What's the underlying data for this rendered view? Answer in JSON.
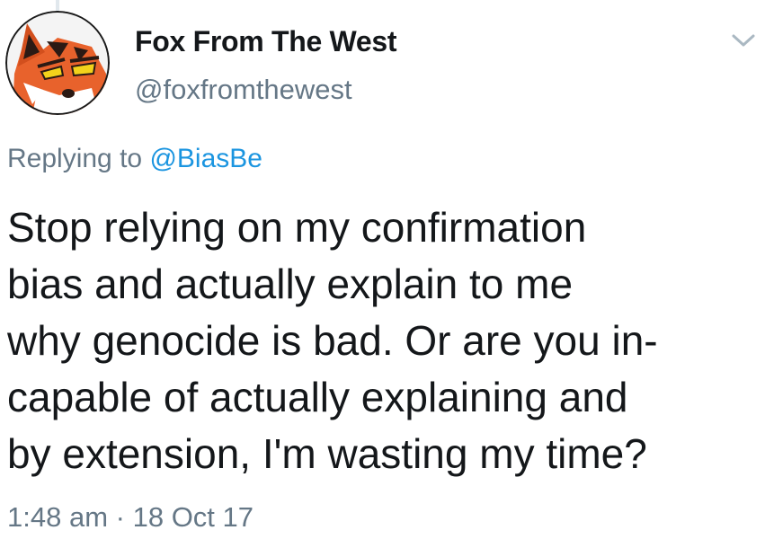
{
  "tweet": {
    "author": {
      "display_name": "Fox From The West",
      "handle": "@foxfromthewest",
      "avatar_icon": "fox-avatar-icon"
    },
    "menu_icon": "chevron-down-icon",
    "reply": {
      "prefix": "Replying to",
      "mention": "@BiasBe"
    },
    "text": "Stop relying on my confirmation\nbias and actually explain to me\nwhy genocide is bad. Or are you in-\ncapable of actually explaining and\nby extension, I'm wasting my time?",
    "time": "1:48 am",
    "separator": "·",
    "date": "18 Oct 17"
  },
  "colors": {
    "text": "#14171a",
    "secondary": "#657786",
    "link": "#1b95e0",
    "fox_orange": "#e8622c",
    "fox_eye": "#f2d21b"
  }
}
